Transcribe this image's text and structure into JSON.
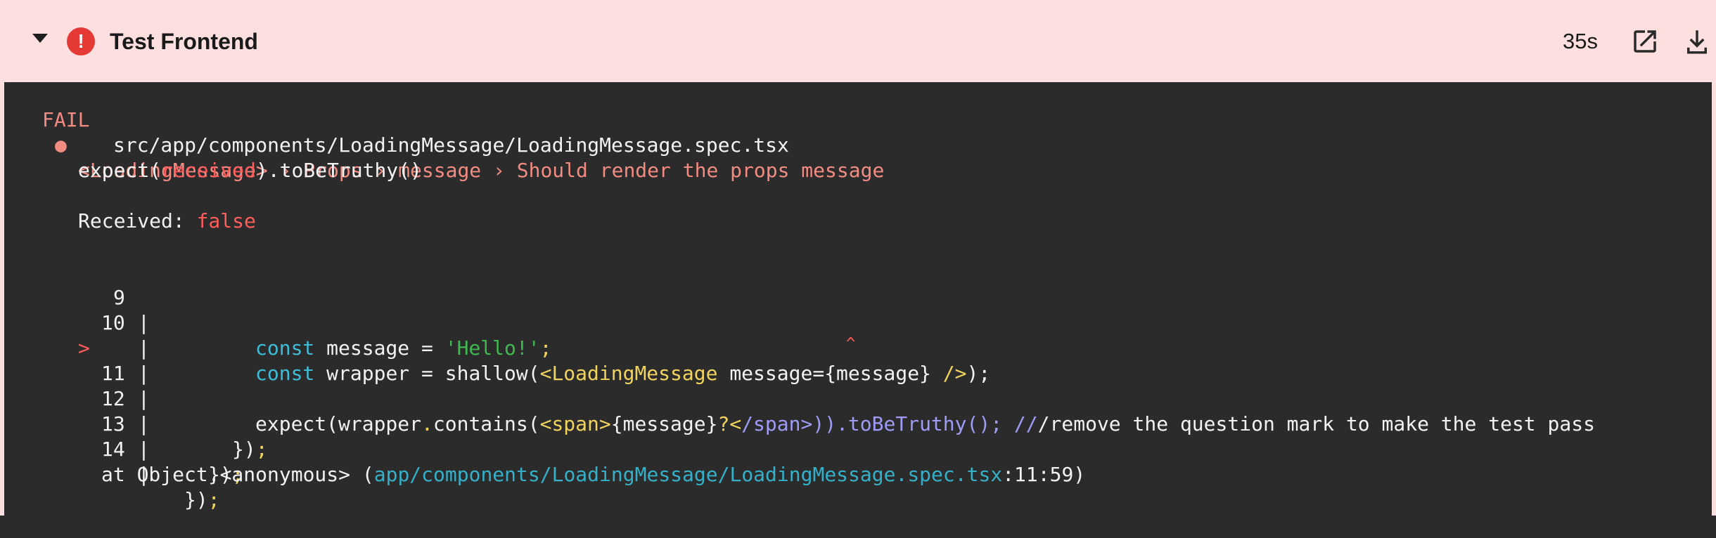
{
  "header": {
    "title": "Test Frontend",
    "duration": "35s",
    "status_icon": "error-icon",
    "error_glyph": "!",
    "open_icon": "open-in-new-icon",
    "download_icon": "download-icon",
    "colors": {
      "header_bg": "#fddfe0",
      "error": "#e53935",
      "log_bg": "#2b2b2b"
    }
  },
  "log": {
    "fail_label": "FAIL",
    "fail_path": "src/app/components/LoadingMessage/LoadingMessage.spec.tsx",
    "bullet": "●",
    "test_name": "<LoadingMessage> › Props › message › Should render the props message",
    "expect_prefix": "expect(",
    "expect_received": "received",
    "expect_suffix": ").toBeTruthy()",
    "received_label": "Received: ",
    "received_value": "false",
    "code_lines": {
      "l9": {
        "num": "9",
        "sep": "|",
        "kw": "const",
        "ident": " message = ",
        "str": "'Hello!'",
        "semi": ";"
      },
      "l10": {
        "num": "10",
        "sep": "|",
        "kw": "const",
        "ident": " wrapper = shallow(",
        "tag_open": "<LoadingMessage",
        "attr": " message=",
        "expr": "{message}",
        "tag_close": " />",
        "end": ");"
      },
      "l11": {
        "marker": ">",
        "num": "11",
        "sep": "|",
        "call": "expect(wrapper",
        "dot": ".",
        "method": "contains(",
        "span_open": "<span>",
        "expr": "{message}",
        "q": "?",
        "span_close_lt": "<",
        "span_close": "/span>",
        "paren": "))",
        "to_truthy": ".toBeTruthy();",
        "comment_slash": " //",
        "comment": "/remove the question mark to make the test pass"
      },
      "caret_sep": "|",
      "caret": "^",
      "l12": {
        "num": "12",
        "sep": "|",
        "body": "});"
      },
      "l13": {
        "num": "13",
        "sep": "|",
        "body": "});"
      },
      "l14": {
        "num": "14",
        "sep": "|",
        "body": "});"
      }
    },
    "stack_prefix": "at Object.<anonymous> (",
    "stack_path": "app/components/LoadingMessage/LoadingMessage.spec.tsx",
    "stack_suffix": ":11:59)"
  }
}
